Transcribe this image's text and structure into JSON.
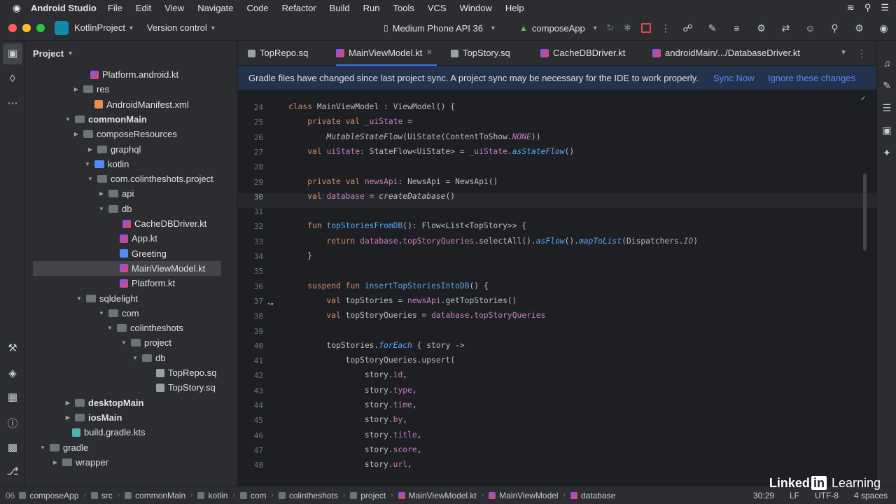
{
  "menubar": {
    "app": "Android Studio",
    "items": [
      "File",
      "Edit",
      "View",
      "Navigate",
      "Code",
      "Refactor",
      "Build",
      "Run",
      "Tools",
      "VCS",
      "Window",
      "Help"
    ]
  },
  "toolbar": {
    "project": "KotlinProject",
    "vcs": "Version control",
    "device": "Medium Phone API 36",
    "module": "composeApp"
  },
  "project_panel": {
    "title": "Project",
    "tree": [
      {
        "label": "Platform.android.kt",
        "icon": "kotlin-file-icon",
        "expanded": null,
        "bold": false
      },
      {
        "label": "res",
        "icon": "folder-icon",
        "expanded": false,
        "bold": false
      },
      {
        "label": "AndroidManifest.xml",
        "icon": "xml-file-icon",
        "expanded": null,
        "bold": false
      },
      {
        "label": "commonMain",
        "icon": "folder-icon",
        "expanded": true,
        "bold": true
      },
      {
        "label": "composeResources",
        "icon": "folder-icon",
        "expanded": false,
        "bold": false
      },
      {
        "label": "graphql",
        "icon": "folder-icon",
        "expanded": false,
        "bold": false
      },
      {
        "label": "kotlin",
        "icon": "source-folder-icon",
        "expanded": true,
        "bold": false
      },
      {
        "label": "com.colintheshots.project",
        "icon": "folder-icon",
        "expanded": true,
        "bold": false
      },
      {
        "label": "api",
        "icon": "folder-icon",
        "expanded": false,
        "bold": false
      },
      {
        "label": "db",
        "icon": "folder-icon",
        "expanded": true,
        "bold": false
      },
      {
        "label": "CacheDBDriver.kt",
        "icon": "kotlin-file-icon",
        "expanded": null,
        "bold": false
      },
      {
        "label": "App.kt",
        "icon": "kotlin-file-icon",
        "expanded": null,
        "bold": false
      },
      {
        "label": "Greeting",
        "icon": "kotlin-class-icon",
        "expanded": null,
        "bold": false
      },
      {
        "label": "MainViewModel.kt",
        "icon": "kotlin-file-icon",
        "expanded": null,
        "bold": false
      },
      {
        "label": "Platform.kt",
        "icon": "kotlin-file-icon",
        "expanded": null,
        "bold": false
      },
      {
        "label": "sqldelight",
        "icon": "folder-icon",
        "expanded": true,
        "bold": false
      },
      {
        "label": "com",
        "icon": "folder-icon",
        "expanded": true,
        "bold": false
      },
      {
        "label": "colintheshots",
        "icon": "folder-icon",
        "expanded": true,
        "bold": false
      },
      {
        "label": "project",
        "icon": "folder-icon",
        "expanded": true,
        "bold": false
      },
      {
        "label": "db",
        "icon": "folder-icon",
        "expanded": true,
        "bold": false
      },
      {
        "label": "TopRepo.sq",
        "icon": "sql-file-icon",
        "expanded": null,
        "bold": false
      },
      {
        "label": "TopStory.sq",
        "icon": "sql-file-icon",
        "expanded": null,
        "bold": false
      },
      {
        "label": "desktopMain",
        "icon": "folder-icon",
        "expanded": false,
        "bold": true
      },
      {
        "label": "iosMain",
        "icon": "folder-icon",
        "expanded": false,
        "bold": true
      },
      {
        "label": "build.gradle.kts",
        "icon": "gradle-file-icon",
        "expanded": null,
        "bold": false
      },
      {
        "label": "gradle",
        "icon": "folder-icon",
        "expanded": true,
        "bold": false
      },
      {
        "label": "wrapper",
        "icon": "folder-icon",
        "expanded": false,
        "bold": false
      }
    ]
  },
  "tabs": [
    {
      "label": "TopRepo.sq",
      "active": false
    },
    {
      "label": "MainViewModel.kt",
      "active": true
    },
    {
      "label": "TopStory.sq",
      "active": false
    },
    {
      "label": "CacheDBDriver.kt",
      "active": false
    },
    {
      "label": "androidMain/.../DatabaseDriver.kt",
      "active": false
    }
  ],
  "banner": {
    "message": "Gradle files have changed since last project sync. A project sync may be necessary for the IDE to work properly.",
    "sync": "Sync Now",
    "ignore": "Ignore these changes"
  },
  "code": {
    "current_line": 30,
    "lines": [
      {
        "n": "24",
        "html": "<span class='kw'>class</span> MainViewModel : ViewModel() {"
      },
      {
        "n": "25",
        "html": "    <span class='kw'>private val</span> <span class='pr'>_uiState</span> ="
      },
      {
        "n": "26",
        "html": "        <span class='it'>MutableStateFlow</span>(UiState(ContentToShow.<span class='cn'>NONE</span>))"
      },
      {
        "n": "27",
        "html": "    <span class='kw'>val</span> <span class='pr'>uiState</span>: StateFlow&lt;UiState&gt; = <span class='pr'>_uiState</span>.<span class='itfn'>asStateFlow</span>()"
      },
      {
        "n": "28",
        "html": ""
      },
      {
        "n": "29",
        "html": "    <span class='kw'>private val</span> <span class='pr'>newsApi</span>: NewsApi = NewsApi()"
      },
      {
        "n": "30",
        "html": "    <span class='kw'>val</span> <span class='pr'>database</span> = <span class='it'>createDatabase</span>()"
      },
      {
        "n": "31",
        "html": ""
      },
      {
        "n": "32",
        "html": "    <span class='kw'>fun</span> <span class='fn'>topStoriesFromDB</span>(): Flow&lt;List&lt;TopStory&gt;&gt; {"
      },
      {
        "n": "33",
        "html": "        <span class='kw'>return</span> <span class='pr'>database</span>.<span class='pr'>topStoryQueries</span>.selectAll().<span class='itfn'>asFlow</span>().<span class='itfn'>mapToList</span>(Dispatchers.<span class='cn'>IO</span>)"
      },
      {
        "n": "34",
        "html": "    }"
      },
      {
        "n": "35",
        "html": ""
      },
      {
        "n": "36",
        "html": "    <span class='kw'>suspend fun</span> <span class='fn'>insertTopStoriesIntoDB</span>() {"
      },
      {
        "n": "37",
        "html": "        <span class='kw'>val</span> topStories = <span class='pr'>newsApi</span>.getTopStories()"
      },
      {
        "n": "38",
        "html": "        <span class='kw'>val</span> topStoryQueries = <span class='pr'>database</span>.<span class='pr'>topStoryQueries</span>"
      },
      {
        "n": "39",
        "html": ""
      },
      {
        "n": "40",
        "html": "        topStories.<span class='itfn'>forEach</span> { story -&gt;"
      },
      {
        "n": "41",
        "html": "            topStoryQueries.upsert("
      },
      {
        "n": "42",
        "html": "                story.<span class='pr'>id</span>,"
      },
      {
        "n": "43",
        "html": "                story.<span class='pr'>type</span>,"
      },
      {
        "n": "44",
        "html": "                story.<span class='pr'>time</span>,"
      },
      {
        "n": "45",
        "html": "                story.<span class='pr'>by</span>,"
      },
      {
        "n": "46",
        "html": "                story.<span class='pr'>title</span>,"
      },
      {
        "n": "47",
        "html": "                story.<span class='pr'>score</span>,"
      },
      {
        "n": "48",
        "html": "                story.<span class='pr'>url</span>,"
      }
    ]
  },
  "statusbar": {
    "breadcrumb": [
      "composeApp",
      "src",
      "commonMain",
      "kotlin",
      "com",
      "colintheshots",
      "project",
      "MainViewModel.kt",
      "MainViewModel",
      "database"
    ],
    "position": "30:29",
    "line_sep": "LF",
    "encoding": "UTF-8",
    "indent": "4 spaces"
  },
  "branding": {
    "part1": "Linked",
    "part2": "in",
    "part3": " Learning"
  }
}
